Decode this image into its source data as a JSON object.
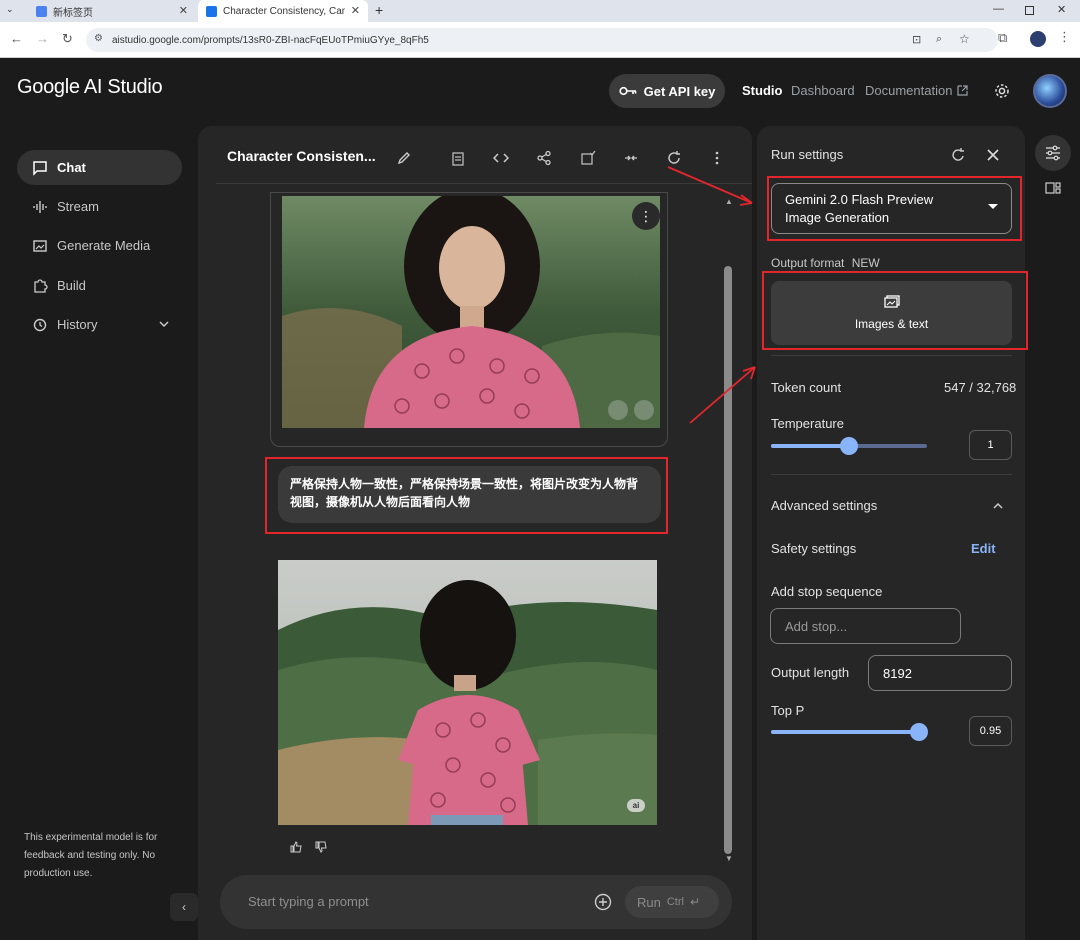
{
  "browser": {
    "tabs": [
      {
        "title": "新标签页"
      },
      {
        "title": "Character Consistency, Came"
      }
    ],
    "url": "aistudio.google.com/prompts/13sR0-ZBI-nacFqEUoTPmiuGYye_8qFh5"
  },
  "header": {
    "logo": "Google AI Studio",
    "api_key_label": "Get API key",
    "nav": {
      "studio": "Studio",
      "dashboard": "Dashboard",
      "documentation": "Documentation"
    }
  },
  "sidebar": {
    "items": [
      {
        "label": "Chat",
        "icon": "chat-icon"
      },
      {
        "label": "Stream",
        "icon": "waveform-icon"
      },
      {
        "label": "Generate Media",
        "icon": "media-icon"
      },
      {
        "label": "Build",
        "icon": "puzzle-icon"
      },
      {
        "label": "History",
        "icon": "history-icon"
      }
    ],
    "disclaimer": "This experimental model is for feedback and testing only. No production use."
  },
  "chat": {
    "title": "Character Consisten...",
    "user_message": "严格保持人物一致性，严格保持场景一致性，将图片改变为人物背视图，摄像机从人物后面看向人物",
    "image_badge": "ai",
    "prompt_placeholder": "Start typing a prompt",
    "run_label": "Run",
    "run_shortcut": "Ctrl"
  },
  "settings": {
    "title": "Run settings",
    "model": "Gemini 2.0 Flash Preview Image Generation",
    "output_format_label": "Output format",
    "output_format_badge": "NEW",
    "output_format_value": "Images & text",
    "token_count_label": "Token count",
    "token_count_value": "547 / 32,768",
    "temperature_label": "Temperature",
    "temperature_value": "1",
    "temperature_level": 0.5,
    "advanced_label": "Advanced settings",
    "safety_label": "Safety settings",
    "safety_edit": "Edit",
    "stop_label": "Add stop sequence",
    "stop_placeholder": "Add stop...",
    "output_length_label": "Output length",
    "output_length_value": "8192",
    "top_p_label": "Top P",
    "top_p_value": "0.95",
    "top_p_level": 0.95
  },
  "colors": {
    "accent": "#8ab4f8",
    "annotation_red": "#e3262c",
    "panel_bg": "#262626",
    "app_bg": "#1b1b1b"
  }
}
